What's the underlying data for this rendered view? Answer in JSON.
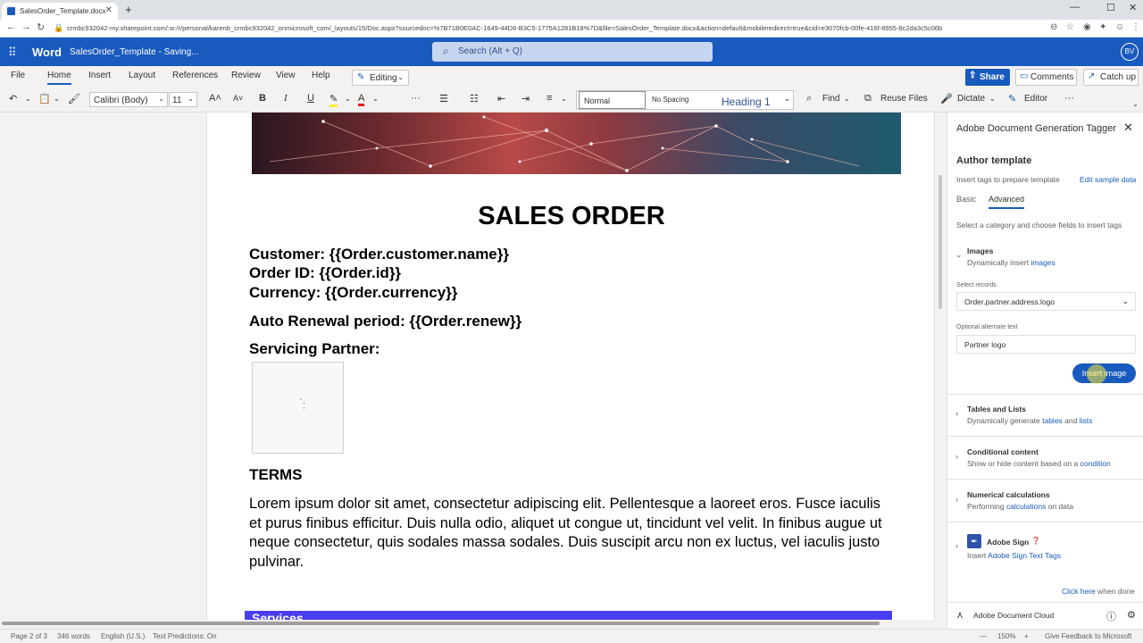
{
  "browser": {
    "tab_title": "SalesOrder_Template.docx",
    "url": "crmbc932042-my.sharepoint.com/:w:/r/personal/karenb_crmbc932042_onmicrosoft_com/_layouts/15/Doc.aspx?sourcedoc=%7B71B0E0AC-1649-44D6-B3C5-1775A1281B18%7D&file=SalesOrder_Template.docx&action=default&mobileredirect=true&cid=e3070fcb-00fe-416f-8955-8c2da3c5c06b"
  },
  "word": {
    "app_name": "Word",
    "doc_name": "SalesOrder_Template  -  Saving...",
    "search_placeholder": "Search (Alt + Q)",
    "avatar": "BV"
  },
  "menu": {
    "items": [
      "File",
      "Home",
      "Insert",
      "Layout",
      "References",
      "Review",
      "View",
      "Help"
    ],
    "editing": "Editing",
    "share": "Share",
    "comments": "Comments",
    "catch_up": "Catch up"
  },
  "ribbon": {
    "font_name": "Calibri (Body)",
    "font_size": "11",
    "styles": [
      "Normal",
      "No Spacing",
      "Heading 1"
    ],
    "find": "Find",
    "reuse_files": "Reuse Files",
    "dictate": "Dictate",
    "editor": "Editor"
  },
  "document": {
    "title": "SALES ORDER",
    "lines": [
      "Customer: {{Order.customer.name}}",
      "Order ID: {{Order.id}}",
      "Currency: {{Order.currency}}",
      "Auto Renewal period: {{Order.renew}}",
      "Servicing Partner:"
    ],
    "terms_heading": "TERMS",
    "terms_body": "Lorem ipsum dolor sit amet, consectetur adipiscing elit. Pellentesque a laoreet eros. Fusce iaculis et purus finibus efficitur. Duis nulla odio, aliquet ut congue ut, tincidunt vel velit. In finibus augue ut neque consectetur, quis sodales massa sodales. Duis suscipit arcu non ex luctus, vel iaculis justo pulvinar.",
    "services_label": "Services"
  },
  "panel": {
    "title": "Adobe Document Generation Tagger",
    "author_heading": "Author template",
    "insert_hint": "Insert tags to prepare template",
    "edit_sample": "Edit sample data",
    "tabs": [
      "Basic",
      "Advanced"
    ],
    "category_hint": "Select a category and choose fields to insert tags",
    "images": {
      "title": "Images",
      "desc": "Dynamically insert ",
      "desc_link": "images",
      "select_label": "Select records",
      "select_value": "Order.partner.address.logo",
      "alt_label": "Optional alternate text",
      "alt_value": "Partner logo",
      "button": "Insert image"
    },
    "tables": {
      "title": "Tables and Lists",
      "desc": "Dynamically generate ",
      "link1": "tables",
      "and": " and ",
      "link2": "lists"
    },
    "conditional": {
      "title": "Conditional content",
      "desc": "Show or hide content based on a ",
      "link": "condition"
    },
    "numerical": {
      "title": "Numerical calculations",
      "desc": "Performing ",
      "link": "calculations",
      "after": " on data"
    },
    "adobe_sign": {
      "title": "Adobe Sign",
      "desc": "Insert ",
      "link": "Adobe Sign Text Tags"
    },
    "click_here": "Click here",
    "when_done": " when done",
    "footer": "Adobe Document Cloud"
  },
  "status": {
    "page": "Page 2 of 3",
    "words": "346 words",
    "language": "English (U.S.)",
    "predictions": "Text Predictions: On",
    "zoom": "150%",
    "feedback": "Give Feedback to Microsoft"
  }
}
